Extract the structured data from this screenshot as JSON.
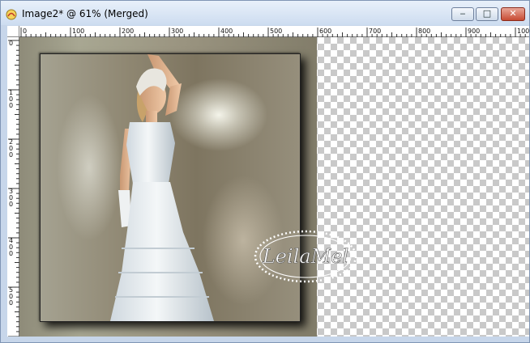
{
  "window": {
    "title": "Image2* @  61% (Merged)",
    "buttons": {
      "minimize": "‒",
      "maximize": "□",
      "close": "✕"
    }
  },
  "rulers": {
    "horizontal_labels": [
      "0",
      "100",
      "200",
      "300",
      "400",
      "500",
      "600",
      "700",
      "800",
      "900",
      "1000"
    ],
    "vertical_labels": [
      "0",
      "100",
      "200",
      "300",
      "400",
      "500"
    ]
  },
  "canvas": {
    "zoom_percent": 61,
    "layer": "Merged",
    "watermark_text": "LeilaMel"
  },
  "colors": {
    "titlebar": "#cddcf0",
    "close_button": "#c74b33",
    "checker": "#c9c9c9"
  }
}
